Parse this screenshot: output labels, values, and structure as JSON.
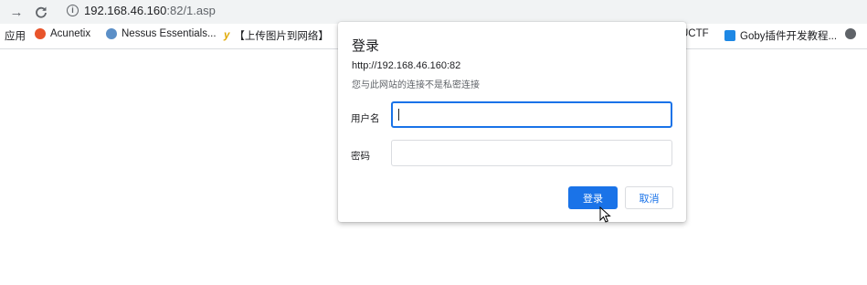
{
  "browser": {
    "url_host": "192.168.46.160",
    "url_rest": ":82/1.asp"
  },
  "bookmarks": [
    {
      "label": "应用",
      "icon": "apps-icon"
    },
    {
      "label": "Acunetix",
      "icon": "acunetix-icon",
      "color": "#e8542b"
    },
    {
      "label": "Nessus Essentials...",
      "icon": "nessus-icon",
      "color": "#5b8fc7"
    },
    {
      "label": "【上传图片到网络】",
      "icon": "upload-icon",
      "color": "#e0a800"
    },
    {
      "label": "UCTF",
      "icon": "folder-icon"
    },
    {
      "label": "Goby插件开发教程...",
      "icon": "goby-icon",
      "color": "#1e88e5"
    },
    {
      "label": "",
      "icon": "globe-icon"
    }
  ],
  "dialog": {
    "title": "登录",
    "url": "http://192.168.46.160:82",
    "warning": "您与此网站的连接不是私密连接",
    "username_label": "用户名",
    "password_label": "密码",
    "username_value": "",
    "password_value": "",
    "login_button": "登录",
    "cancel_button": "取消"
  },
  "colors": {
    "accent": "#1a73e8"
  }
}
